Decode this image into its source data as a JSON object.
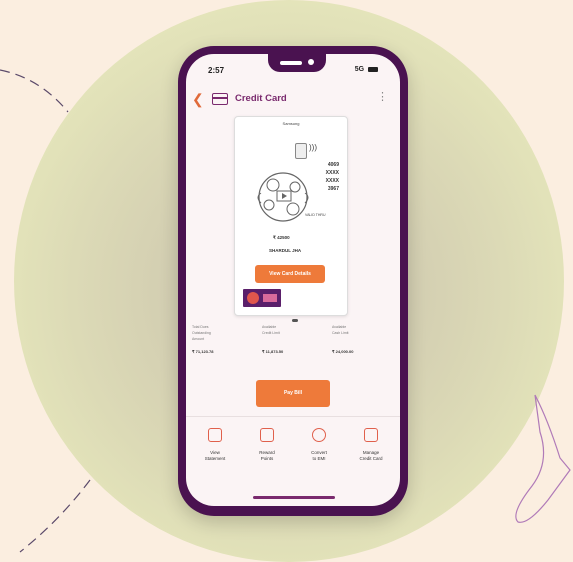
{
  "status": {
    "time": "2:57",
    "network": "5G"
  },
  "appbar": {
    "title": "Credit Card"
  },
  "card": {
    "brand": "Samsung",
    "number": [
      "4069",
      "XXXX",
      "XXXX",
      "3967"
    ],
    "valid": "VALID THRU",
    "limit": "₹ 42500",
    "holder": "SHARDUL JHA",
    "view_button": "View Card Details"
  },
  "stats": [
    {
      "label": "Total Dues\nOutstanding\nAmount",
      "value": "₹ 71,123.78"
    },
    {
      "label": "Available\nCredit Limit",
      "value": "₹ 11,873.50"
    },
    {
      "label": "Available\nCash Limit",
      "value": "₹ 24,000.00"
    }
  ],
  "pay_button": "Pay Bill",
  "actions": [
    {
      "label": "View\nStatement",
      "icon": "statement-icon"
    },
    {
      "label": "Reward\nPoints",
      "icon": "gift-icon"
    },
    {
      "label": "Convert\nto EMI",
      "icon": "emi-icon"
    },
    {
      "label": "Manage\nCredit Card",
      "icon": "manage-card-icon"
    }
  ],
  "colors": {
    "accent": "#ee7a3a",
    "brand": "#4a1250",
    "title": "#7a2a6e"
  }
}
